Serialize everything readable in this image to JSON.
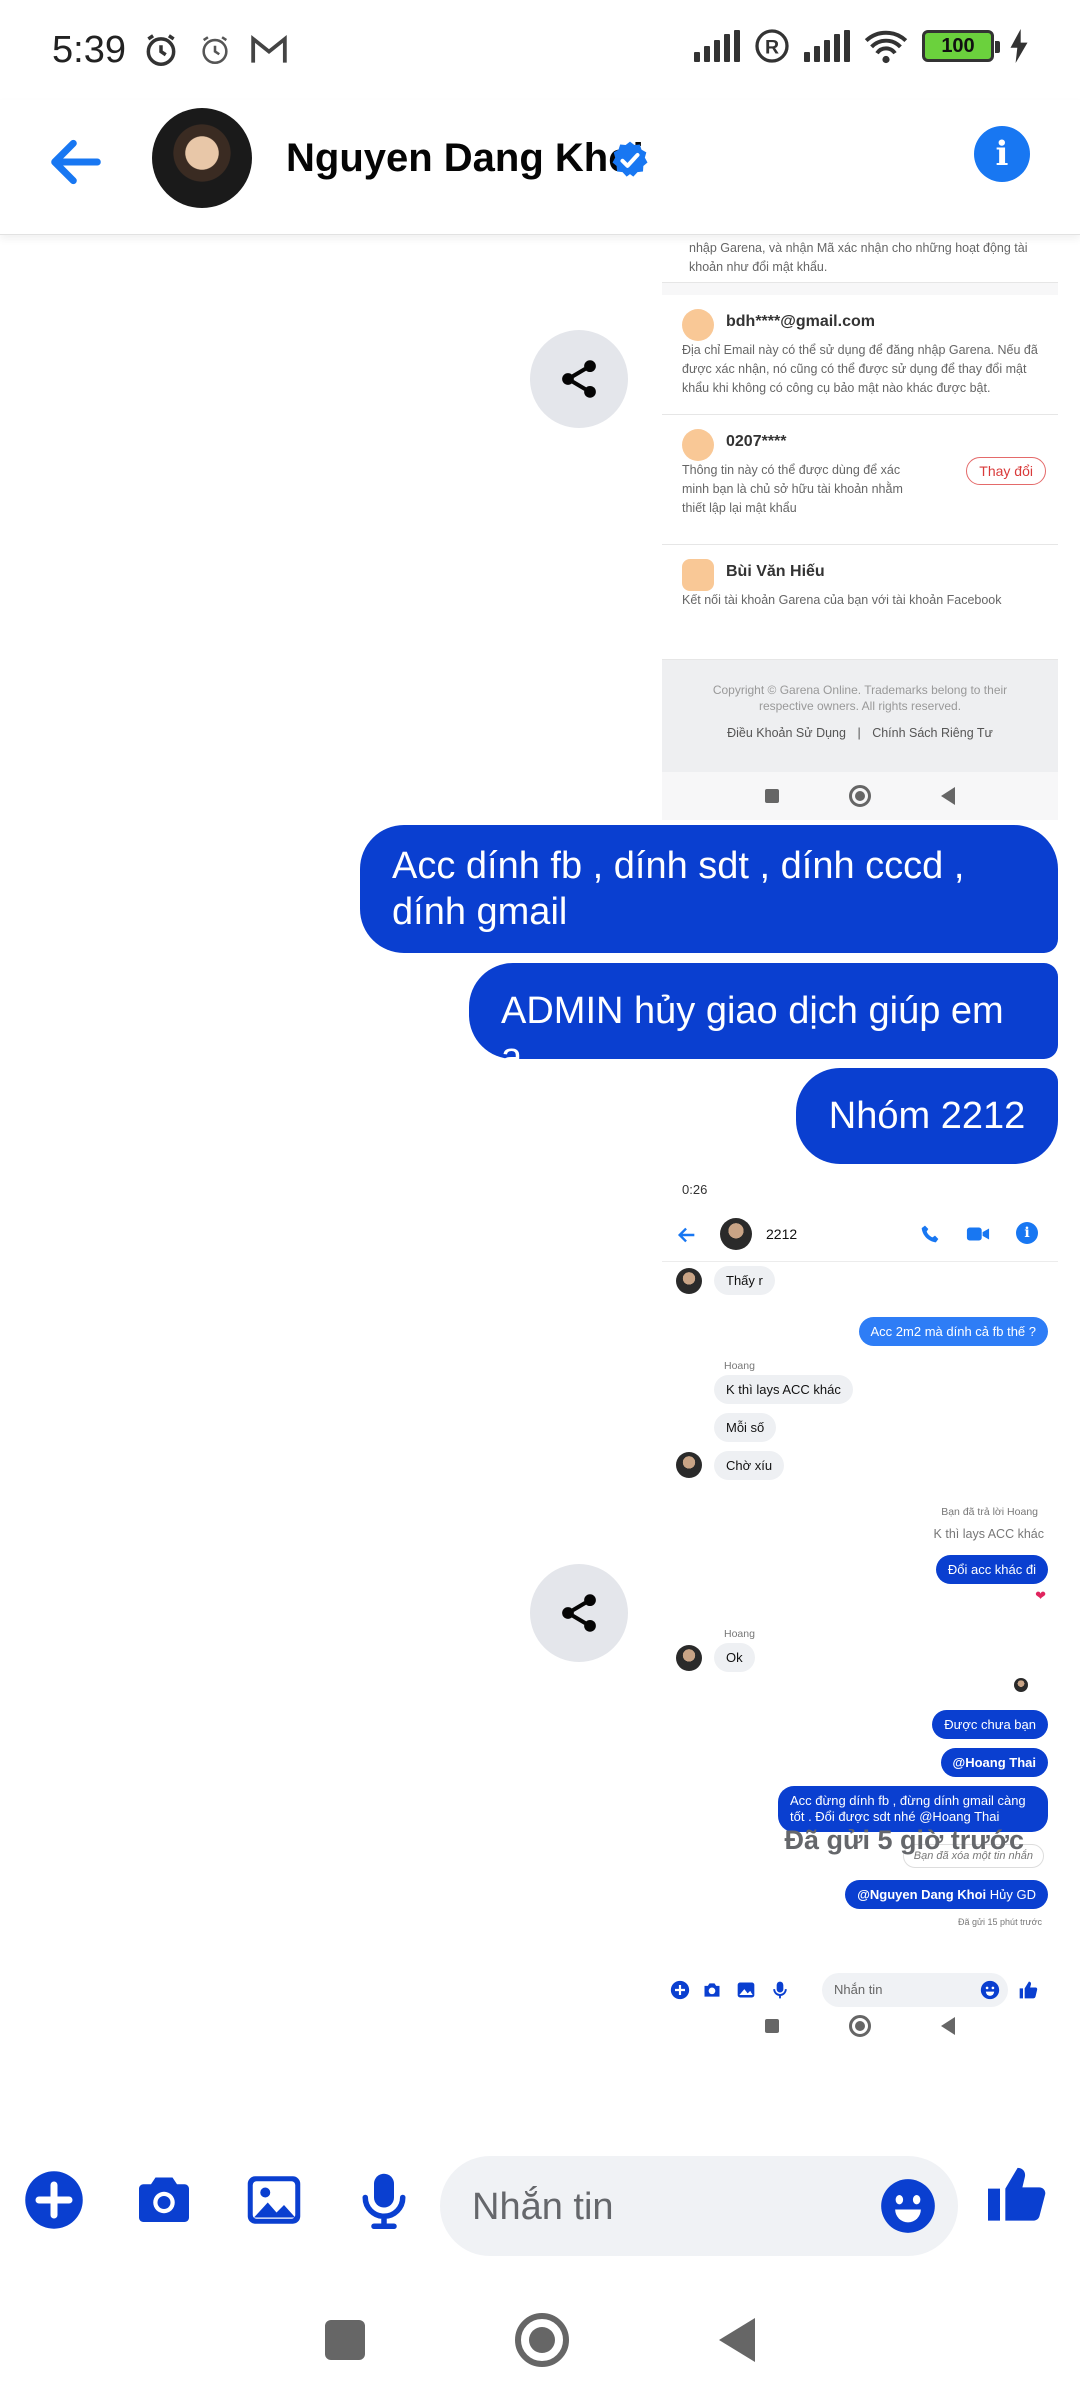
{
  "status_bar": {
    "time": "5:39",
    "battery": "100"
  },
  "header": {
    "name": "Nguyen Dang Khoi"
  },
  "messages": {
    "m1": "Acc dính fb , dính sdt , dính cccd , dính gmail",
    "m2": "ADMIN hủy giao dịch giúp em ạ",
    "m3": "Nhóm 2212",
    "sent_time": "Đã gửi 5 giờ trước"
  },
  "garena_shot": {
    "top_desc": "nhập Garena, và nhận Mã xác nhận cho những hoạt động tài khoản như đổi mật khẩu.",
    "email_title": "bdh****@gmail.com",
    "email_desc": "Địa chỉ Email này có thể sử dụng để đăng nhập Garena. Nếu đã được xác nhận, nó cũng có thể được sử dụng để thay đổi mật khẩu khi không có công cụ bảo mật nào khác được bật.",
    "phone_title": "0207****",
    "phone_desc": "Thông tin này có thể được dùng để xác minh bạn là chủ sở hữu tài khoản nhằm thiết lập lại mật khẩu",
    "change_label": "Thay đổi",
    "fb_title": "Bùi Văn Hiếu",
    "fb_desc": "Kết nối tài khoản Garena của bạn với tài khoản Facebook",
    "copyright": "Copyright © Garena Online. Trademarks belong to their respective owners. All rights reserved.",
    "terms": "Điều Khoản Sử Dụng",
    "sep": "|",
    "privacy": "Chính Sách Riêng Tư"
  },
  "chat_shot": {
    "status_time": "0:26",
    "group_name": "2212",
    "msg_thay": "Thấy r",
    "msg_acc2m2": "Acc 2m2 mà dính cả fb thế ?",
    "sender_hoang": "Hoang",
    "msg_k_thi": "K thì lays ACC khác",
    "msg_moi_so": "Mỗi số",
    "msg_cho_xiu": "Chờ xíu",
    "replied_to": "Bạn đã trả lời Hoang",
    "quoted": "K thì lays ACC khác",
    "msg_doi_acc": "Đổi acc khác đi",
    "msg_ok": "Ok",
    "msg_duoc_chua": "Được chưa bạn",
    "msg_hoang_thai": "@Hoang Thai",
    "msg_acc_dung": "Acc đừng dính fb , đừng dính gmail càng tốt . Đổi được sdt nhé @Hoang Thai",
    "unsent": "Bạn đã xóa một tin nhắn",
    "msg_huy_mention": "@Nguyen Dang Khoi",
    "msg_huy_text": "Hủy GD",
    "sent_ago": "Đã gửi 15 phút trước",
    "input_placeholder": "Nhắn tin"
  },
  "composer": {
    "placeholder": "Nhắn tin"
  },
  "colors": {
    "accent": "#1877f2",
    "bubble": "#0a3fd0",
    "composer_icons": "#0a3fd0"
  },
  "icons": [
    "back-arrow-icon",
    "verified-icon",
    "info-icon",
    "share-icon",
    "add-icon",
    "camera-icon",
    "gallery-icon",
    "mic-icon",
    "emoji-icon",
    "like-icon"
  ]
}
